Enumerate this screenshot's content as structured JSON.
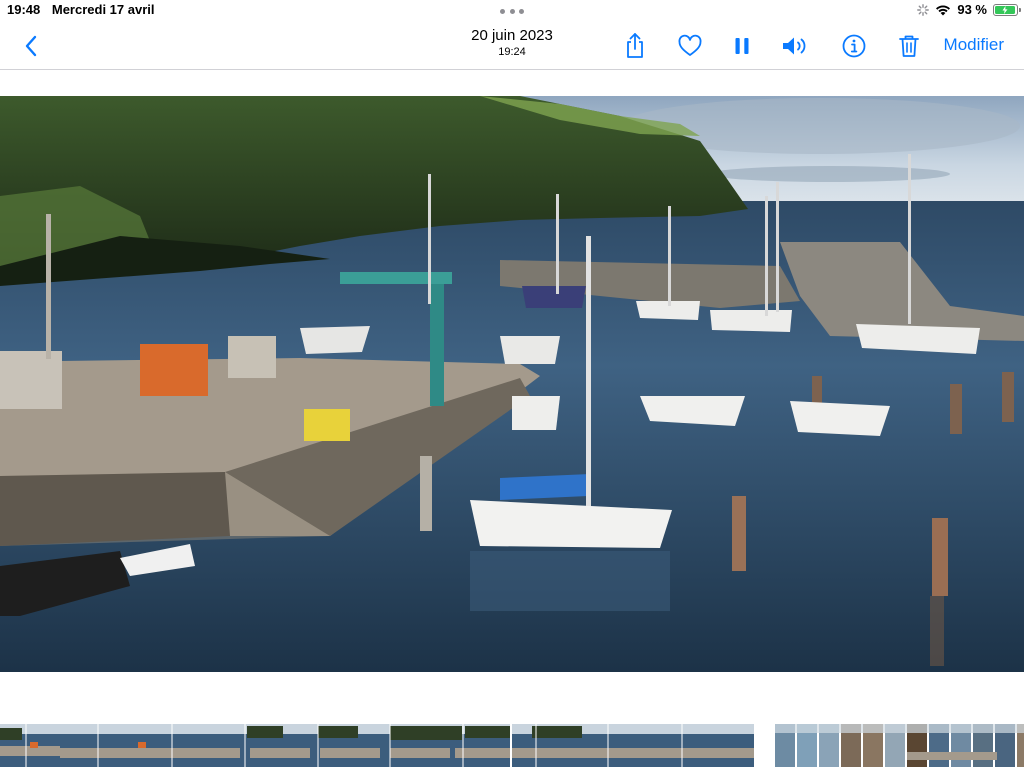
{
  "status_bar": {
    "time": "19:48",
    "date": "Mercredi 17 avril",
    "battery_percent": "93 %",
    "battery_level": 0.93
  },
  "nav": {
    "title_date": "20 juin 2023",
    "title_time": "19:24",
    "modify_label": "Modifier",
    "icons": [
      "chevron-left-icon",
      "share-icon",
      "heart-icon",
      "pause-icon",
      "speaker-icon",
      "info-icon",
      "trash-icon"
    ]
  },
  "colors": {
    "accent": "#0a7aff",
    "battery": "#34c759"
  }
}
